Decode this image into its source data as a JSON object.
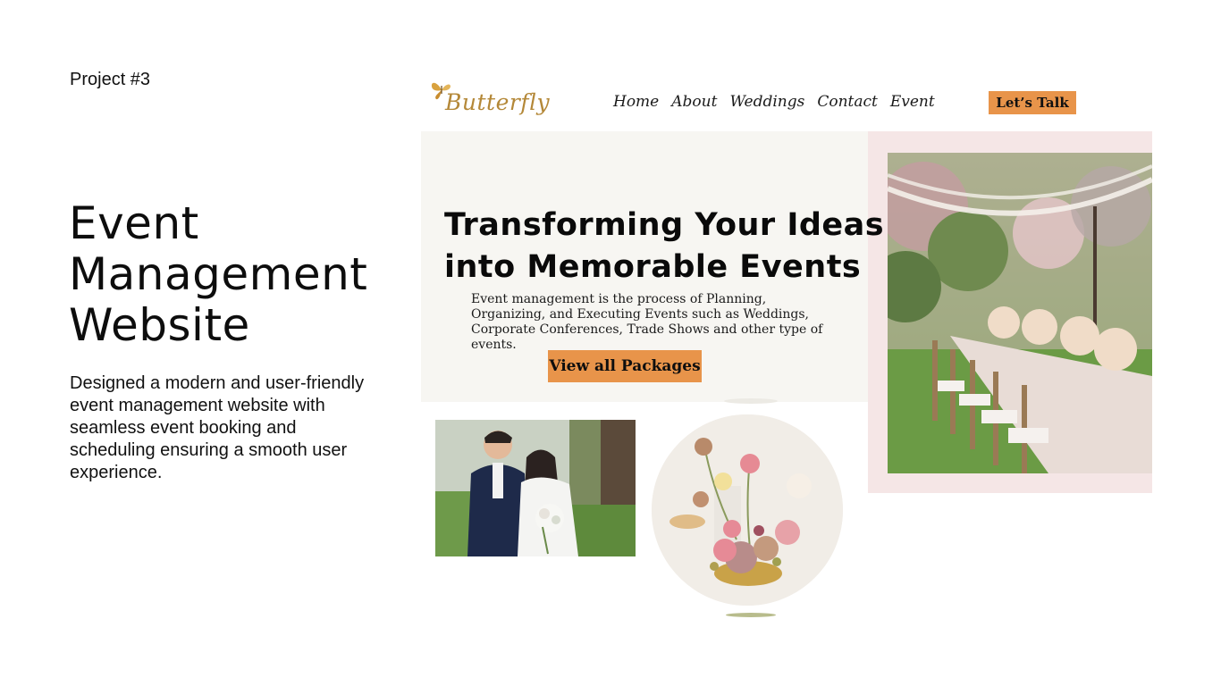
{
  "project": {
    "label": "Project #3",
    "title_lines": [
      "Event",
      "Management",
      "Website"
    ],
    "description": "Designed a modern and user-friendly event management website with seamless event booking and scheduling ensuring a smooth user experience."
  },
  "site": {
    "logo_text": "Butterfly",
    "logo_icon": "butterfly-icon",
    "nav": [
      "Home",
      "About",
      "Weddings",
      "Contact",
      "Event"
    ],
    "cta_label": "Let’s Talk",
    "hero": {
      "headline_lines": [
        "Transforming Your Ideas",
        "into Memorable Events"
      ],
      "subtext": "Event management is the process of Planning, Organizing, and Executing Events such as Weddings, Corporate Conferences, Trade Shows and other type of events.",
      "button_label": "View all Packages"
    }
  },
  "colors": {
    "accent": "#e8944a",
    "logo_gold": "#b48838",
    "hero_bg": "#f7f6f2",
    "panel_pink": "#f5e6e6"
  }
}
